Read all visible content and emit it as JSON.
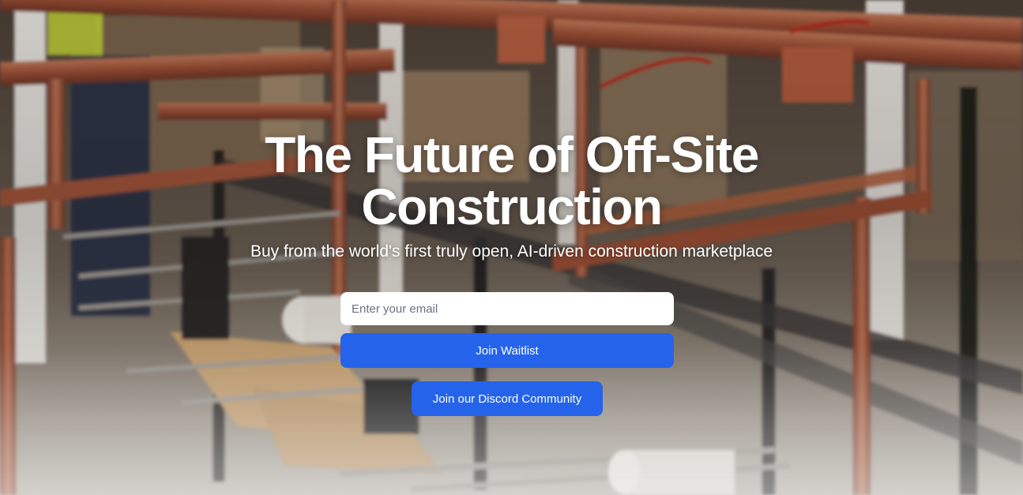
{
  "hero": {
    "title_line1": "The Future of Off-Site",
    "title_line2": "Construction",
    "subtitle": "Buy from the world's first truly open, AI-driven construction marketplace",
    "background_description": "blurred-photo-of-pipe-fabrication-rack-with-copper-pipes"
  },
  "waitlist_form": {
    "email_placeholder": "Enter your email",
    "email_value": "",
    "submit_label": "Join Waitlist"
  },
  "discord": {
    "label": "Join our Discord Community"
  },
  "colors": {
    "accent": "#2563eb",
    "title_text": "#ffffff",
    "input_background": "#ffffff",
    "placeholder_text": "#6b7280"
  }
}
